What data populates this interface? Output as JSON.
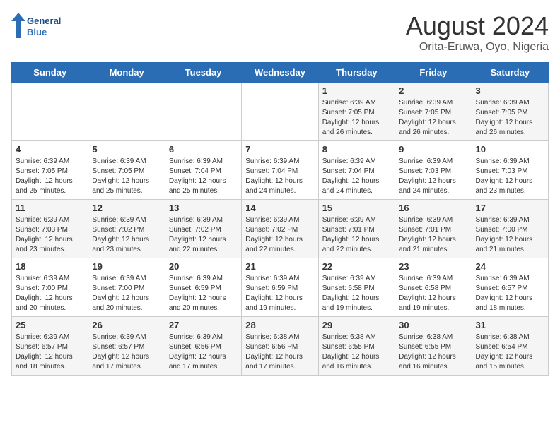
{
  "logo": {
    "line1": "General",
    "line2": "Blue"
  },
  "title": "August 2024",
  "location": "Orita-Eruwa, Oyo, Nigeria",
  "days_of_week": [
    "Sunday",
    "Monday",
    "Tuesday",
    "Wednesday",
    "Thursday",
    "Friday",
    "Saturday"
  ],
  "weeks": [
    [
      {
        "day": "",
        "info": ""
      },
      {
        "day": "",
        "info": ""
      },
      {
        "day": "",
        "info": ""
      },
      {
        "day": "",
        "info": ""
      },
      {
        "day": "1",
        "info": "Sunrise: 6:39 AM\nSunset: 7:05 PM\nDaylight: 12 hours\nand 26 minutes."
      },
      {
        "day": "2",
        "info": "Sunrise: 6:39 AM\nSunset: 7:05 PM\nDaylight: 12 hours\nand 26 minutes."
      },
      {
        "day": "3",
        "info": "Sunrise: 6:39 AM\nSunset: 7:05 PM\nDaylight: 12 hours\nand 26 minutes."
      }
    ],
    [
      {
        "day": "4",
        "info": "Sunrise: 6:39 AM\nSunset: 7:05 PM\nDaylight: 12 hours\nand 25 minutes."
      },
      {
        "day": "5",
        "info": "Sunrise: 6:39 AM\nSunset: 7:05 PM\nDaylight: 12 hours\nand 25 minutes."
      },
      {
        "day": "6",
        "info": "Sunrise: 6:39 AM\nSunset: 7:04 PM\nDaylight: 12 hours\nand 25 minutes."
      },
      {
        "day": "7",
        "info": "Sunrise: 6:39 AM\nSunset: 7:04 PM\nDaylight: 12 hours\nand 24 minutes."
      },
      {
        "day": "8",
        "info": "Sunrise: 6:39 AM\nSunset: 7:04 PM\nDaylight: 12 hours\nand 24 minutes."
      },
      {
        "day": "9",
        "info": "Sunrise: 6:39 AM\nSunset: 7:03 PM\nDaylight: 12 hours\nand 24 minutes."
      },
      {
        "day": "10",
        "info": "Sunrise: 6:39 AM\nSunset: 7:03 PM\nDaylight: 12 hours\nand 23 minutes."
      }
    ],
    [
      {
        "day": "11",
        "info": "Sunrise: 6:39 AM\nSunset: 7:03 PM\nDaylight: 12 hours\nand 23 minutes."
      },
      {
        "day": "12",
        "info": "Sunrise: 6:39 AM\nSunset: 7:02 PM\nDaylight: 12 hours\nand 23 minutes."
      },
      {
        "day": "13",
        "info": "Sunrise: 6:39 AM\nSunset: 7:02 PM\nDaylight: 12 hours\nand 22 minutes."
      },
      {
        "day": "14",
        "info": "Sunrise: 6:39 AM\nSunset: 7:02 PM\nDaylight: 12 hours\nand 22 minutes."
      },
      {
        "day": "15",
        "info": "Sunrise: 6:39 AM\nSunset: 7:01 PM\nDaylight: 12 hours\nand 22 minutes."
      },
      {
        "day": "16",
        "info": "Sunrise: 6:39 AM\nSunset: 7:01 PM\nDaylight: 12 hours\nand 21 minutes."
      },
      {
        "day": "17",
        "info": "Sunrise: 6:39 AM\nSunset: 7:00 PM\nDaylight: 12 hours\nand 21 minutes."
      }
    ],
    [
      {
        "day": "18",
        "info": "Sunrise: 6:39 AM\nSunset: 7:00 PM\nDaylight: 12 hours\nand 20 minutes."
      },
      {
        "day": "19",
        "info": "Sunrise: 6:39 AM\nSunset: 7:00 PM\nDaylight: 12 hours\nand 20 minutes."
      },
      {
        "day": "20",
        "info": "Sunrise: 6:39 AM\nSunset: 6:59 PM\nDaylight: 12 hours\nand 20 minutes."
      },
      {
        "day": "21",
        "info": "Sunrise: 6:39 AM\nSunset: 6:59 PM\nDaylight: 12 hours\nand 19 minutes."
      },
      {
        "day": "22",
        "info": "Sunrise: 6:39 AM\nSunset: 6:58 PM\nDaylight: 12 hours\nand 19 minutes."
      },
      {
        "day": "23",
        "info": "Sunrise: 6:39 AM\nSunset: 6:58 PM\nDaylight: 12 hours\nand 19 minutes."
      },
      {
        "day": "24",
        "info": "Sunrise: 6:39 AM\nSunset: 6:57 PM\nDaylight: 12 hours\nand 18 minutes."
      }
    ],
    [
      {
        "day": "25",
        "info": "Sunrise: 6:39 AM\nSunset: 6:57 PM\nDaylight: 12 hours\nand 18 minutes."
      },
      {
        "day": "26",
        "info": "Sunrise: 6:39 AM\nSunset: 6:57 PM\nDaylight: 12 hours\nand 17 minutes."
      },
      {
        "day": "27",
        "info": "Sunrise: 6:39 AM\nSunset: 6:56 PM\nDaylight: 12 hours\nand 17 minutes."
      },
      {
        "day": "28",
        "info": "Sunrise: 6:38 AM\nSunset: 6:56 PM\nDaylight: 12 hours\nand 17 minutes."
      },
      {
        "day": "29",
        "info": "Sunrise: 6:38 AM\nSunset: 6:55 PM\nDaylight: 12 hours\nand 16 minutes."
      },
      {
        "day": "30",
        "info": "Sunrise: 6:38 AM\nSunset: 6:55 PM\nDaylight: 12 hours\nand 16 minutes."
      },
      {
        "day": "31",
        "info": "Sunrise: 6:38 AM\nSunset: 6:54 PM\nDaylight: 12 hours\nand 15 minutes."
      }
    ]
  ]
}
